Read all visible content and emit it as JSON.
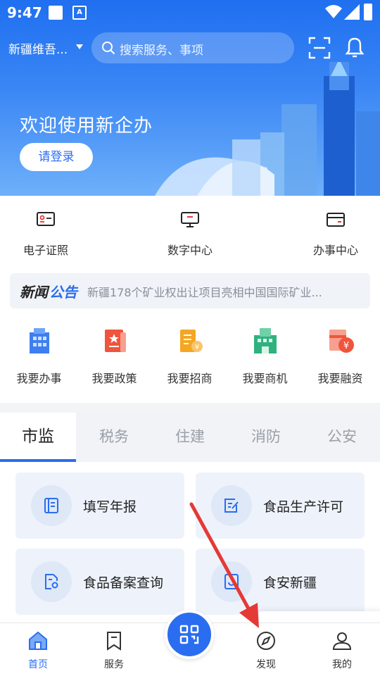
{
  "status_bar": {
    "time": "9:47",
    "notif_icon_letter": "A"
  },
  "header": {
    "region": "新疆维吾...",
    "search_placeholder": "搜索服务、事项",
    "welcome": "欢迎使用新企办",
    "login_label": "请登录"
  },
  "quick_links": [
    {
      "label": "电子证照",
      "icon": "id-card-icon"
    },
    {
      "label": "数字中心",
      "icon": "monitor-icon"
    },
    {
      "label": "办事中心",
      "icon": "card-icon"
    }
  ],
  "notice": {
    "tag_part1": "新闻",
    "tag_part2": "公告",
    "text": "新疆178个矿业权出让项目亮相中国国际矿业..."
  },
  "categories": [
    {
      "label": "我要办事",
      "icon": "building-icon"
    },
    {
      "label": "我要政策",
      "icon": "policy-book-icon"
    },
    {
      "label": "我要招商",
      "icon": "investment-icon"
    },
    {
      "label": "我要商机",
      "icon": "business-building-icon"
    },
    {
      "label": "我要融资",
      "icon": "yuan-coin-icon"
    }
  ],
  "tabs": [
    "市监",
    "税务",
    "住建",
    "消防",
    "公安"
  ],
  "active_tab": "市监",
  "service_cards": [
    {
      "label": "填写年报",
      "icon": "report-icon"
    },
    {
      "label": "食品生产许可",
      "icon": "edit-form-icon"
    },
    {
      "label": "食品备案查询",
      "icon": "file-search-icon"
    },
    {
      "label": "食安新疆",
      "icon": "food-safety-icon"
    }
  ],
  "bottom_nav": [
    {
      "label": "首页",
      "icon": "home-icon",
      "active": true
    },
    {
      "label": "服务",
      "icon": "bookmark-icon",
      "active": false
    },
    {
      "label": "发现",
      "icon": "compass-icon",
      "active": false
    },
    {
      "label": "我的",
      "icon": "user-icon",
      "active": false
    }
  ],
  "colors": {
    "primary": "#2a6df0",
    "arrow": "#e53935"
  }
}
